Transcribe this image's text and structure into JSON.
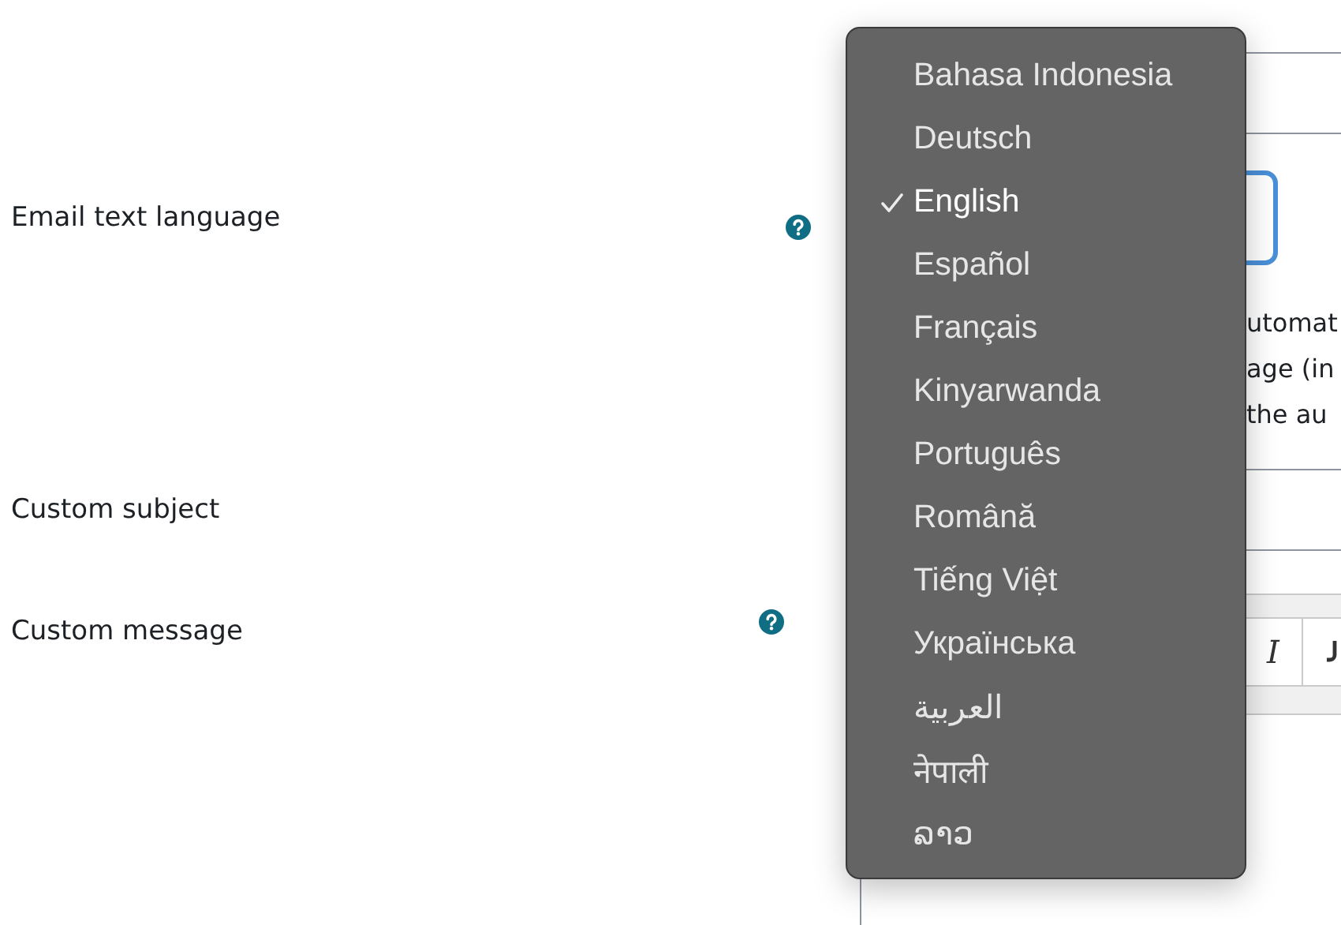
{
  "email_language": {
    "label": "Email text language",
    "description_fragments": [
      "utomat",
      "age (in",
      "the au"
    ]
  },
  "custom_subject": {
    "label": "Custom subject"
  },
  "custom_message": {
    "label": "Custom message",
    "toolbar": [
      {
        "label": "I",
        "kind": "italic"
      },
      {
        "kind": "icon"
      }
    ]
  },
  "language_menu": {
    "items": [
      {
        "label": "Bahasa Indonesia",
        "selected": false
      },
      {
        "label": "Deutsch",
        "selected": false
      },
      {
        "label": "English",
        "selected": true
      },
      {
        "label": "Español",
        "selected": false
      },
      {
        "label": "Français",
        "selected": false
      },
      {
        "label": "Kinyarwanda",
        "selected": false
      },
      {
        "label": "Português",
        "selected": false
      },
      {
        "label": "Română",
        "selected": false
      },
      {
        "label": "Tiếng Việt",
        "selected": false
      },
      {
        "label": "Українська",
        "selected": false
      },
      {
        "label": "العربية",
        "selected": false
      },
      {
        "label": "नेपाली",
        "selected": false
      },
      {
        "label": "ລາວ",
        "selected": false
      }
    ]
  }
}
